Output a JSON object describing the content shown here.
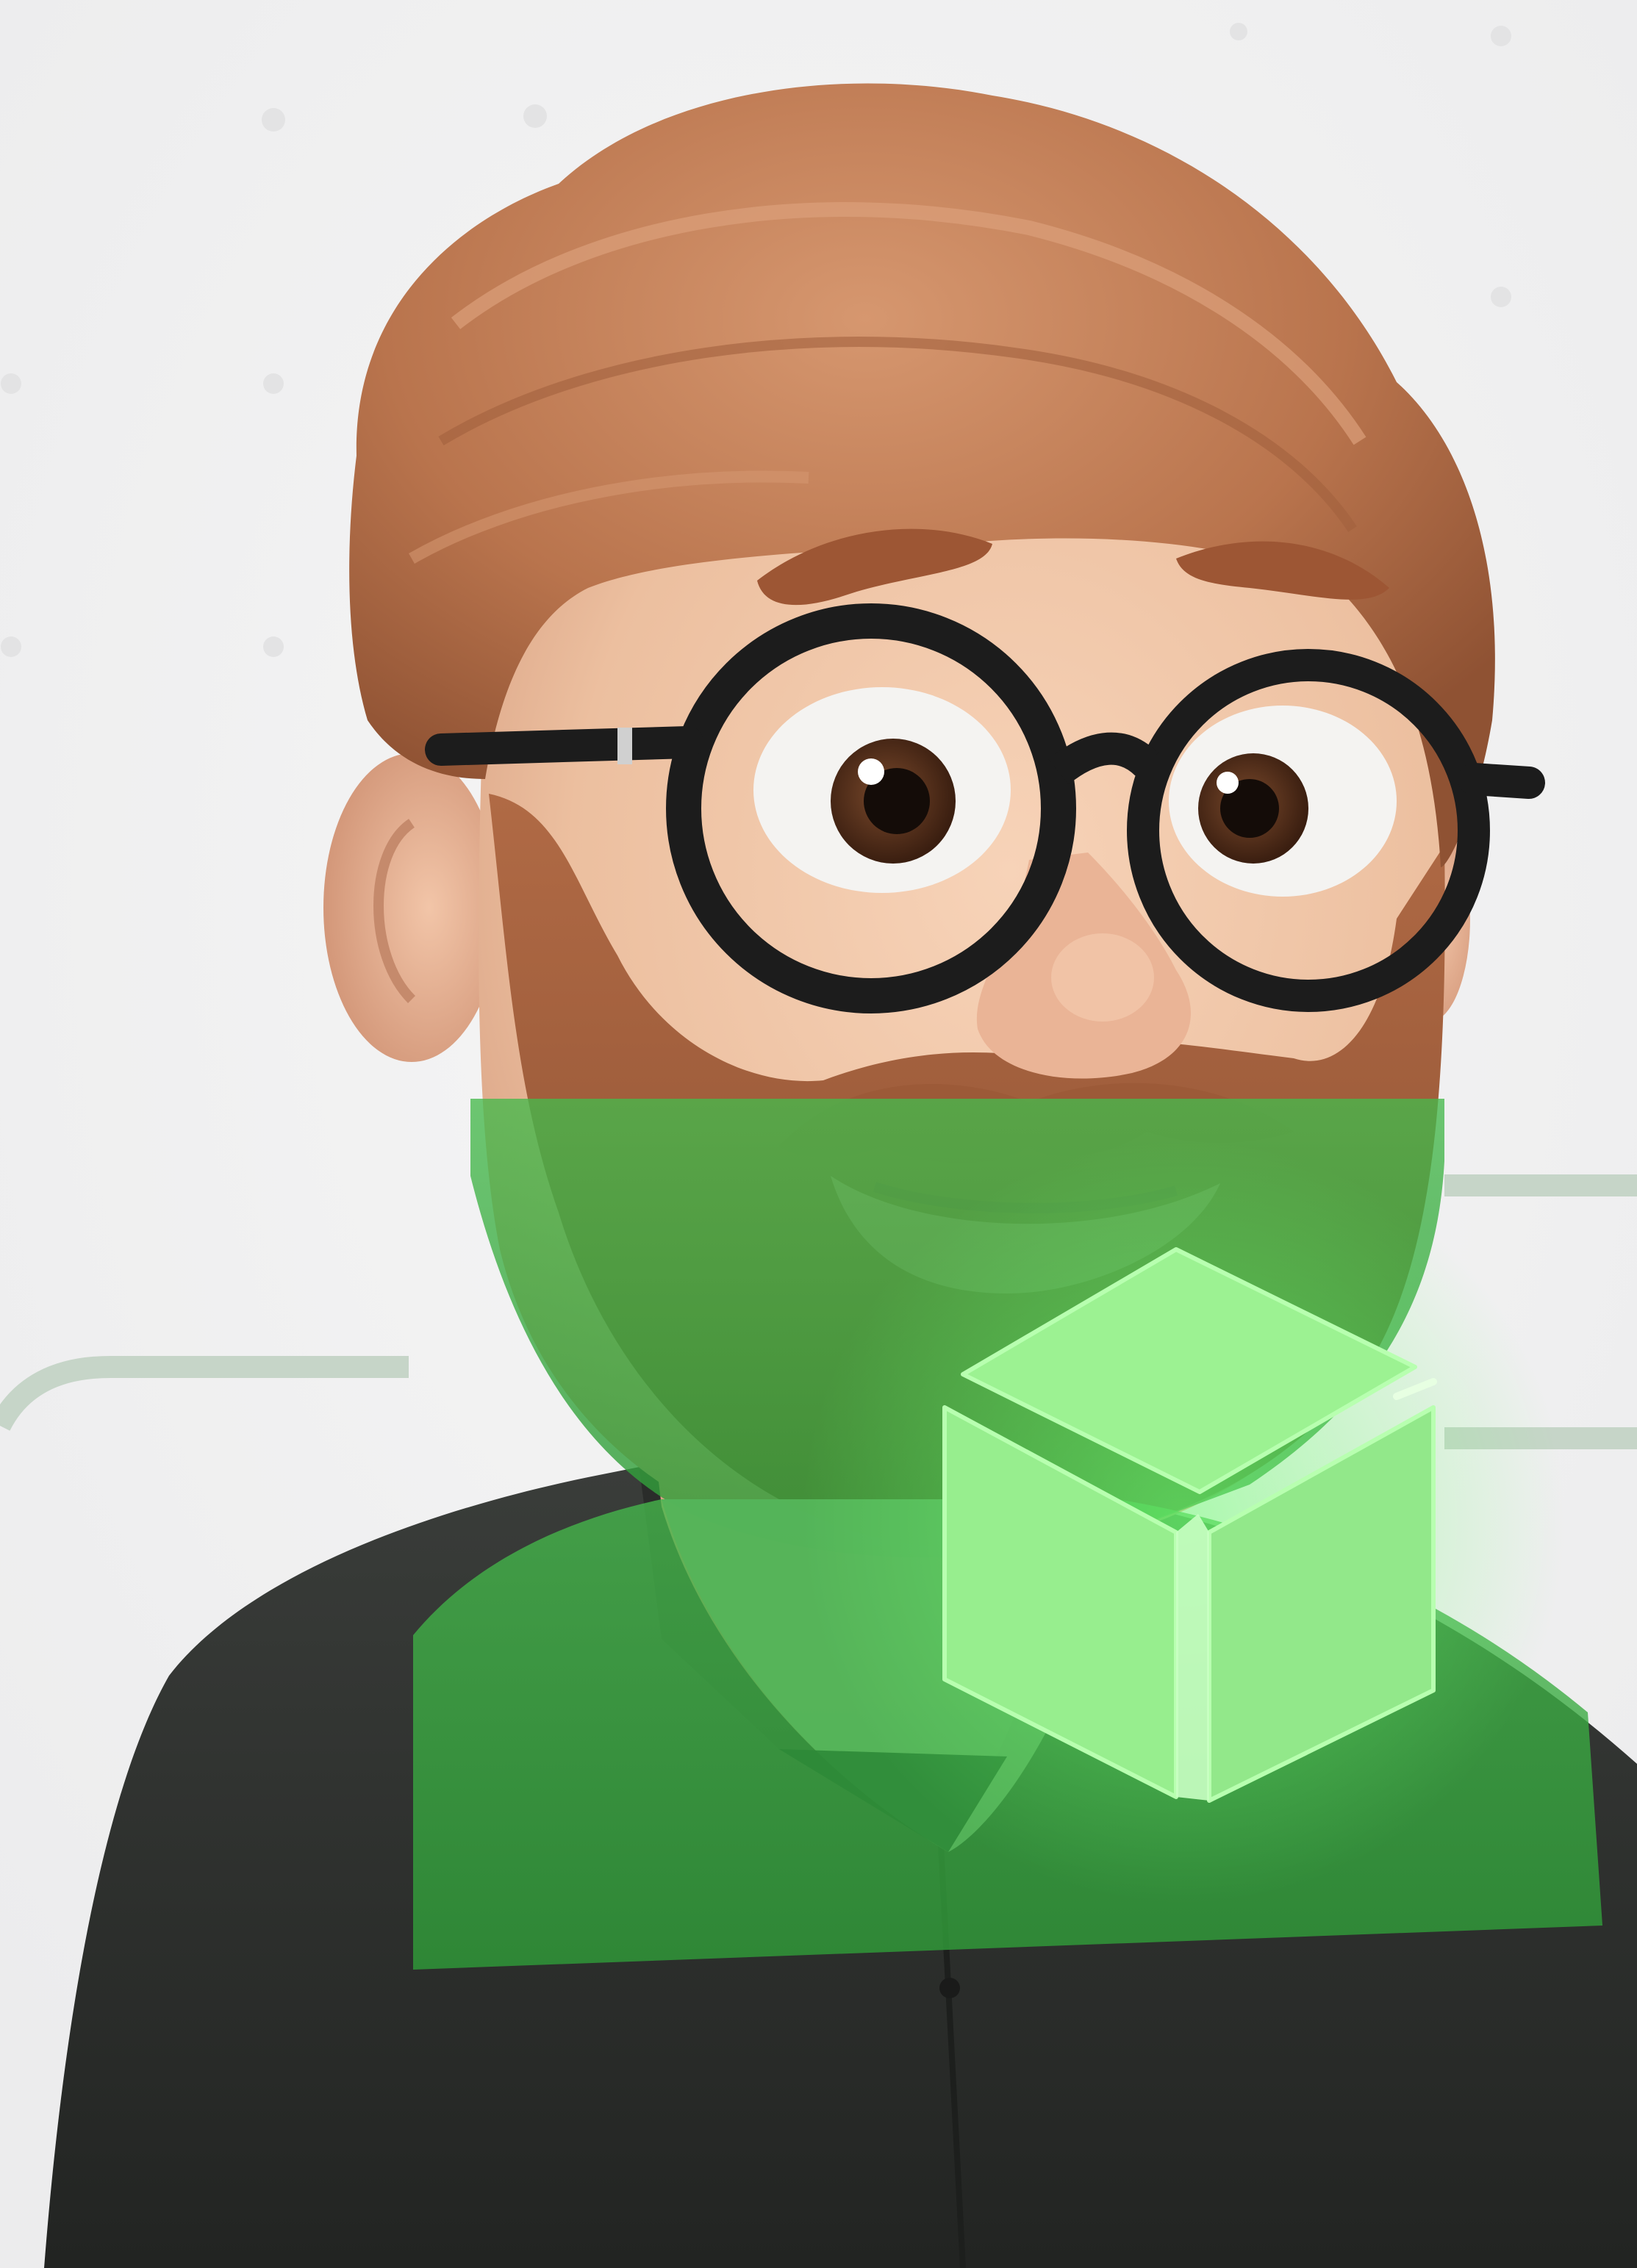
{
  "colors": {
    "background": "#f1f1f2",
    "connector_lines": "#c6d5c8",
    "hair": "#b5704a",
    "hair_highlight": "#d0906a",
    "hair_shadow": "#8a4e30",
    "skin": "#efc3a5",
    "skin_shadow": "#d9a284",
    "glasses_frame": "#1c1c1c",
    "eye_white": "#f4f3f1",
    "iris": "#5c3520",
    "pupil": "#140c08",
    "shirt": "#2d302d",
    "green_overlay": "#34a43e",
    "cube_face": "#97ee8e",
    "cube_top": "#9cf292",
    "cube_glow": "#6cff72"
  },
  "icons": {
    "avatar": "bearded-man-3d-avatar",
    "cube": "3d-cube-icon"
  }
}
